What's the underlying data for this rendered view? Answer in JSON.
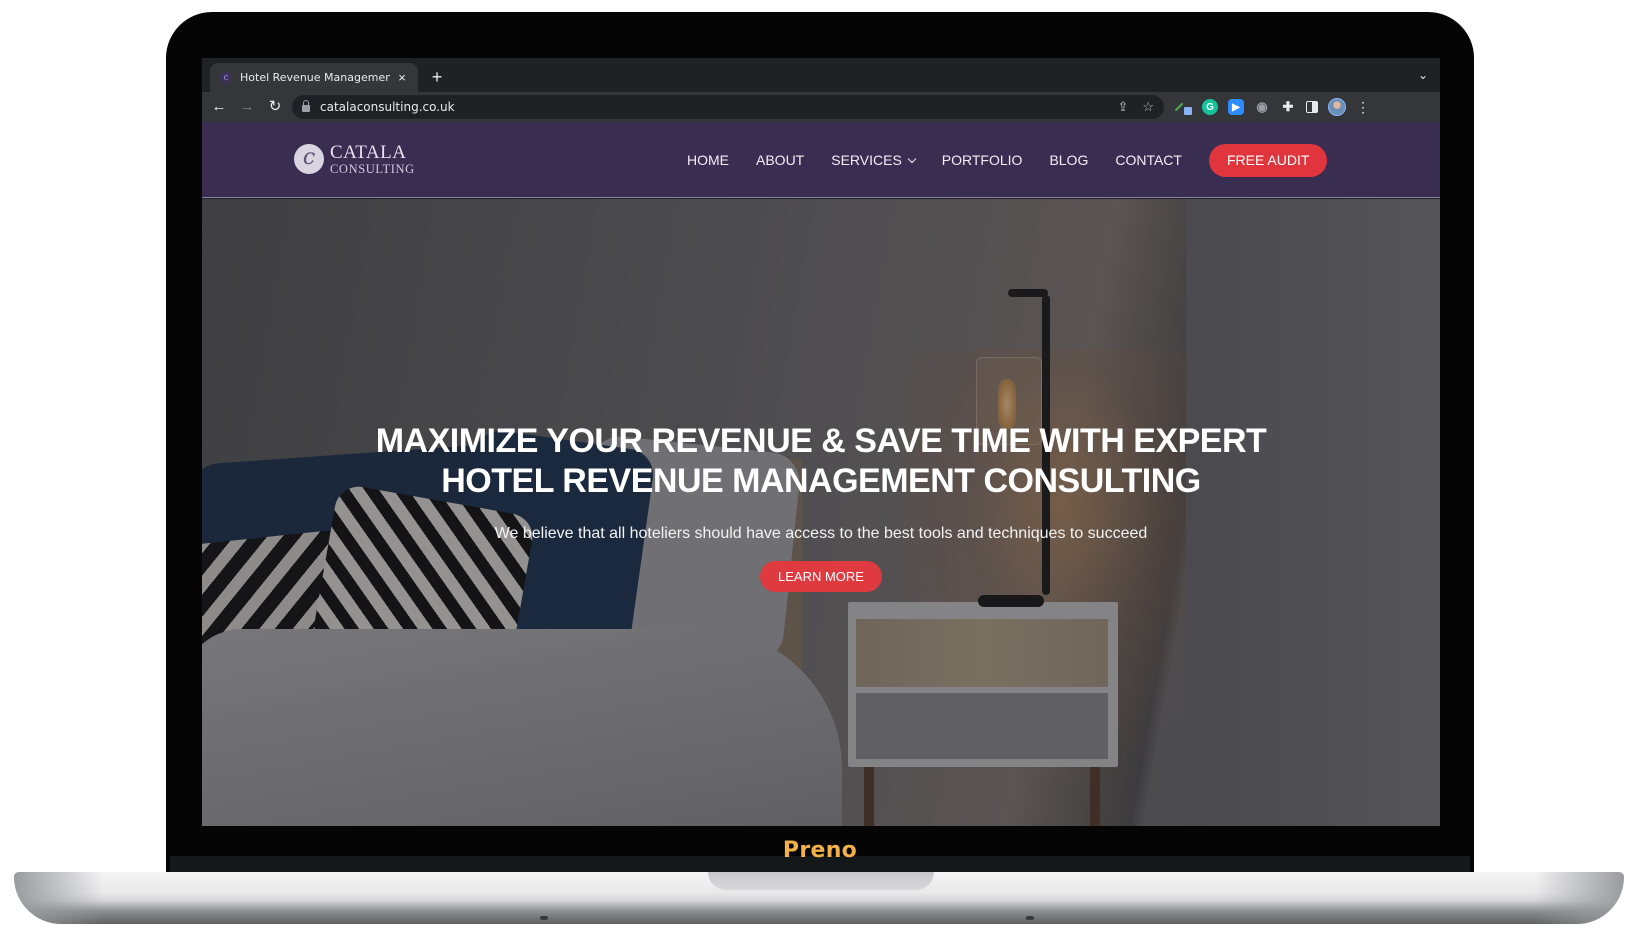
{
  "device": {
    "bezel_label": "Preno",
    "bezel_label_color": "#f2b04a"
  },
  "browser": {
    "tab": {
      "title": "Hotel Revenue Management Co",
      "favicon": "catala-logo-icon",
      "close": "×"
    },
    "new_tab": "+",
    "tab_menu": "⌄",
    "nav": {
      "back": "←",
      "forward": "→",
      "reload": "↻"
    },
    "address": {
      "url": "catalaconsulting.co.uk",
      "share_icon": "⇪",
      "bookmark_icon": "☆"
    },
    "extensions": [
      {
        "name": "color-picker-extension",
        "glyph": ""
      },
      {
        "name": "grammarly-extension",
        "glyph": "G"
      },
      {
        "name": "zoom-extension",
        "glyph": "▶"
      },
      {
        "name": "screenshot-extension",
        "glyph": "◉"
      },
      {
        "name": "extensions-menu",
        "glyph": "✚"
      },
      {
        "name": "side-panel",
        "glyph": ""
      }
    ],
    "menu": "⋮"
  },
  "site": {
    "logo": {
      "mark": "c",
      "line1": "CATALA",
      "line2": "CONSULTING"
    },
    "nav": {
      "items": [
        "HOME",
        "ABOUT",
        "SERVICES",
        "PORTFOLIO",
        "BLOG",
        "CONTACT"
      ],
      "cta": "FREE AUDIT"
    },
    "colors": {
      "header_bg": "#3a2d52",
      "accent_red": "#e0353c"
    },
    "hero": {
      "title_line1": "MAXIMIZE YOUR REVENUE & SAVE TIME WITH EXPERT",
      "title_line2": "HOTEL REVENUE MANAGEMENT CONSULTING",
      "subtitle": "We believe that all hoteliers should have access to the best tools and techniques to succeed",
      "button": "LEARN MORE"
    }
  }
}
